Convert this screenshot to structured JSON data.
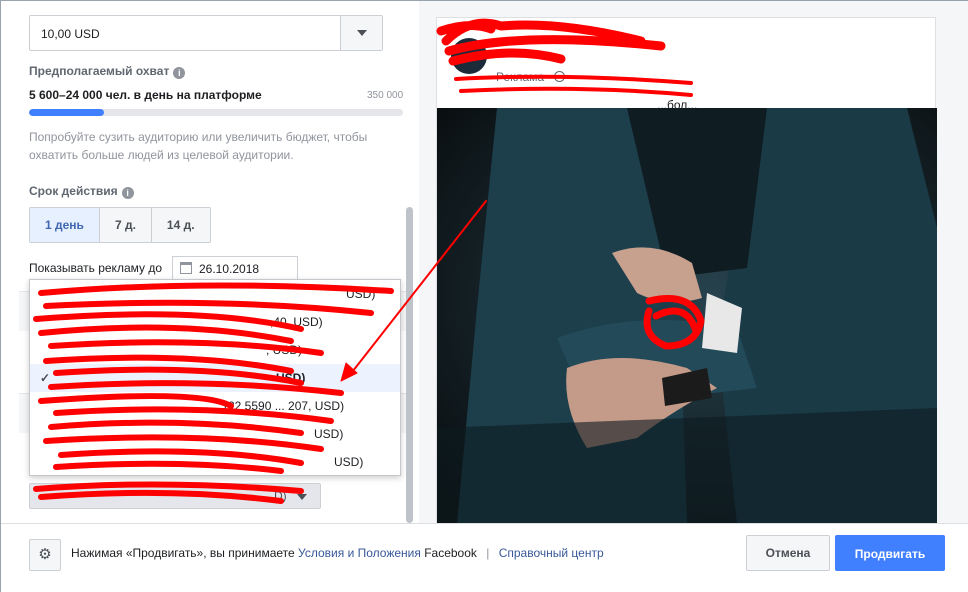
{
  "budget": {
    "value": "10,00 USD"
  },
  "reach": {
    "title": "Предполагаемый охват",
    "estimate": "5 600–24 000 чел. в день на платформе",
    "max_label": "350 000",
    "fill_fraction": 0.2,
    "hint": "Попробуйте сузить аудиторию или увеличить бюджет, чтобы охватить больше людей из целевой аудитории."
  },
  "duration": {
    "title": "Срок действия",
    "options": [
      "1 день",
      "7 д.",
      "14 д."
    ],
    "selected_index": 0,
    "show_until_label": "Показывать рекламу до",
    "end_date": "26.10.2018"
  },
  "dropdown": {
    "items": [
      {
        "label": "USD)",
        "selected": false
      },
      {
        "label": ",40, USD)",
        "selected": false
      },
      {
        "label": ", USD)",
        "selected": false
      },
      {
        "label": "USD)",
        "selected": true
      },
      {
        "label": "(22 5590 ... 207, USD)",
        "selected": false
      },
      {
        "label": "USD)",
        "selected": false
      },
      {
        "label": "USD)",
        "selected": false
      }
    ],
    "bottom_select_label": "D)"
  },
  "preview": {
    "sponsored_label": "Реклама ·",
    "post_text": "...бол..."
  },
  "footer": {
    "terms_prefix": "Нажимая «Продвигать», вы принимаете",
    "terms_link": "Условия и Положения",
    "terms_suffix": "Facebook",
    "separator": "|",
    "help_link": "Справочный центр",
    "cancel_label": "Отмена",
    "boost_label": "Продвигать"
  },
  "colors": {
    "accent": "#4080ff",
    "link": "#385898",
    "redaction": "#ff0000"
  },
  "icons": [
    "info-icon",
    "calendar-icon",
    "check-icon",
    "globe-icon",
    "gear-icon",
    "chevron-down-icon"
  ]
}
